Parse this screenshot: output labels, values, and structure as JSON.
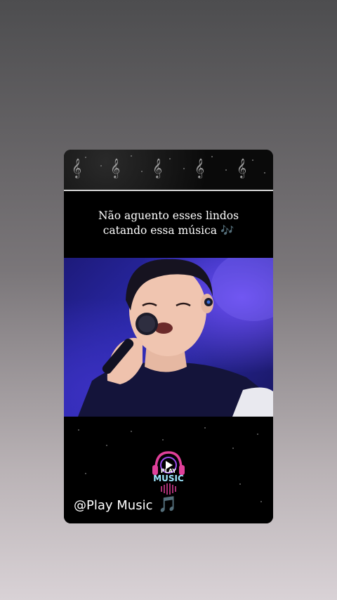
{
  "story": {
    "header_decoration": "music-staff-clefs",
    "caption_line1": "Não aguento esses lindos",
    "caption_line2": "catando essa música",
    "caption_emoji": "🎶",
    "video_description_icon": "singer-with-microphone",
    "logo": {
      "line1": "PLAY",
      "line2": "MUSIC"
    },
    "handle": "@Play Music",
    "handle_emoji": "🎵"
  },
  "colors": {
    "accent_purple": "#b267f2",
    "logo_pink": "#e0409a",
    "video_blue": "#2c2bb0"
  }
}
